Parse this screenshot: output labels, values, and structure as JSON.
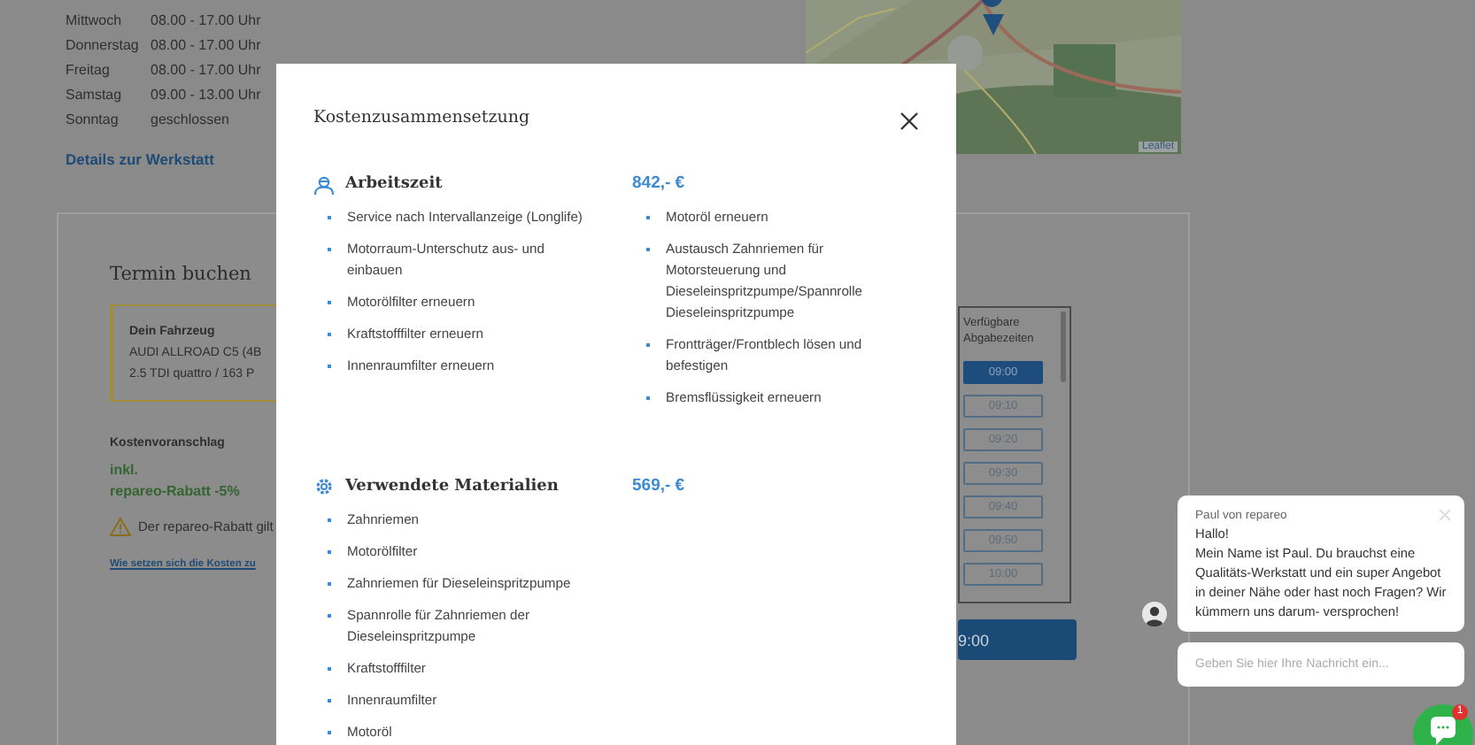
{
  "opening_hours": [
    {
      "day": "Mittwoch",
      "hours": "08.00 - 17.00 Uhr"
    },
    {
      "day": "Donnerstag",
      "hours": "08.00 - 17.00 Uhr"
    },
    {
      "day": "Freitag",
      "hours": "08.00 - 17.00 Uhr"
    },
    {
      "day": "Samstag",
      "hours": "09.00 - 13.00 Uhr"
    },
    {
      "day": "Sonntag",
      "hours": "geschlossen"
    }
  ],
  "workshop_link": "Details zur Werkstatt",
  "map": {
    "kind": "picture",
    "attribution": "Leaflet"
  },
  "booking": {
    "title": "Termin buchen",
    "vehicle": {
      "label": "Dein Fahrzeug",
      "model": "AUDI ALLROAD C5 (4B",
      "engine": "2.5 TDI quattro / 163 P"
    },
    "estimate_label": "Kostenvoranschlag",
    "discount_lines": [
      "inkl.",
      "repareo-Rabatt -5%"
    ],
    "warning": "Der repareo-Rabatt gilt",
    "cost_link": "Wie setzen sich die Kosten zu",
    "slots_heading": "Verfügbare Abgabezeiten",
    "slots": [
      {
        "time": "09:00",
        "selected": true
      },
      {
        "time": "09:10",
        "selected": false
      },
      {
        "time": "09:20",
        "selected": false
      },
      {
        "time": "09:30",
        "selected": false
      },
      {
        "time": "09:40",
        "selected": false
      },
      {
        "time": "09:50",
        "selected": false
      },
      {
        "time": "10:00",
        "selected": false
      }
    ],
    "confirm_button": "9:00"
  },
  "modal": {
    "title": "Kostenzusammensetzung",
    "sections": [
      {
        "kind": "labor",
        "title": "Arbeitszeit",
        "price": "842,- €",
        "columns": [
          [
            "Service nach Intervallanzeige (Longlife)",
            "Motorraum-Unterschutz aus- und einbauen",
            "Motorölfilter erneuern",
            "Kraftstofffilter erneuern",
            "Innenraumfilter erneuern"
          ],
          [
            "Motoröl erneuern",
            "Austausch Zahnriemen für Motorsteuerung und Dieseleinspritzpumpe/Spannrolle Dieseleinspritzpumpe",
            "Frontträger/Frontblech lösen und befestigen",
            "Bremsflüssigkeit erneuern"
          ]
        ]
      },
      {
        "kind": "materials",
        "title": "Verwendete Materialien",
        "price": "569,- €",
        "columns": [
          [
            "Zahnriemen",
            "Motorölfilter",
            "Zahnriemen für Dieseleinspritzpumpe",
            "Spannrolle für Zahnriemen der Dieseleinspritzpumpe",
            "Kraftstofffilter",
            "Innenraumfilter",
            "Motoröl"
          ]
        ]
      }
    ]
  },
  "chat": {
    "agent": "Paul von repareo",
    "greeting": "Hallo!",
    "message": "Mein Name ist Paul. Du brauchst eine Qualitäts-Werkstatt und ein super Angebot in deiner Nähe oder hast noch Fragen? Wir kümmern uns darum- versprochen!",
    "placeholder": "Geben Sie hier Ihre Nachricht ein...",
    "unread": "1"
  }
}
